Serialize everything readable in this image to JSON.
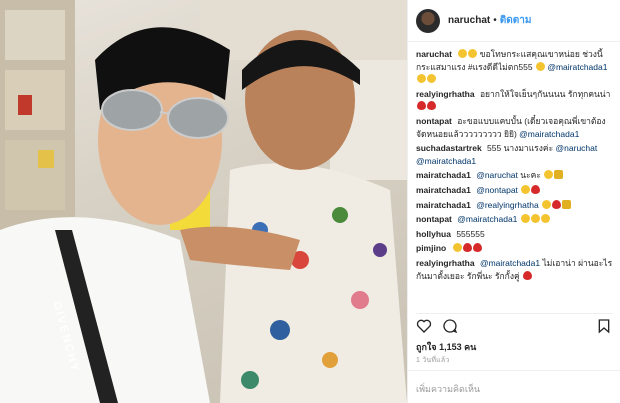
{
  "post": {
    "username": "naruchat",
    "dot": "•",
    "follow_label": "ติดตาม",
    "caption_text": "ขอโทษกระแสคุณเขาหน่อย ช่วงนี้กระแสมาแรง #แรงดีดีไม่ตก555",
    "caption_mention": "@mairatchada1"
  },
  "comments": [
    {
      "user": "realyingrhatha",
      "text": "อยากให้ใจเย็นๆกันนนน รักทุกคนน่า"
    },
    {
      "user": "nontapat",
      "text": "อะขอแบบแคบบั้น (เดี๋ยวเจอคุณพี่เขาต้องจัดหนอยแล้ววววววววว ยิยิ)",
      "mention": "@mairatchada1"
    },
    {
      "user": "suchadastartrek",
      "text": "555 นางมาแรงค่ะ",
      "mention": "@naruchat @mairatchada1"
    },
    {
      "user": "mairatchada1",
      "mention": "@naruchat",
      "text": "นะคะ"
    },
    {
      "user": "mairatchada1",
      "mention": "@nontapat"
    },
    {
      "user": "mairatchada1",
      "mention": "@realyingrhatha"
    },
    {
      "user": "nontapat",
      "mention": "@mairatchada1"
    },
    {
      "user": "hollyhua",
      "text": "555555"
    },
    {
      "user": "pimjino",
      "text": ""
    },
    {
      "user": "realyingrhatha",
      "mention": "@mairatchada1",
      "text": "ไม่เอาน่า ผ่านอะไรกันมาตั้งเยอะ รักพี่นะ รักกั้งคู่"
    }
  ],
  "stats": {
    "likes": "ถูกใจ 1,153 คน",
    "time": "1 วันที่แล้ว"
  },
  "add_comment": {
    "placeholder": "เพิ่มความคิดเห็น"
  },
  "photo": {
    "necklace_text": "GIVENCHY",
    "alt_description": "selfie of two men"
  },
  "icons": {
    "like": "heart-icon",
    "comment": "comment-icon",
    "save": "bookmark-icon"
  },
  "colors": {
    "link": "#003569",
    "follow": "#3897f0",
    "heart": "#d62a2a"
  }
}
